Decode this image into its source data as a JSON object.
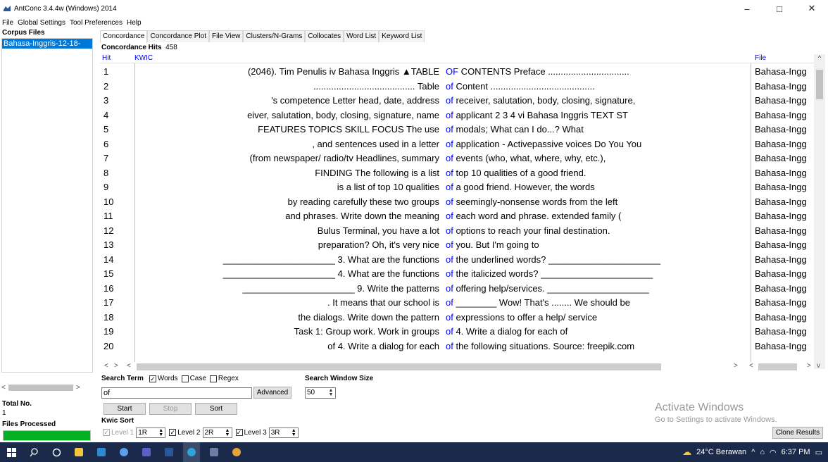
{
  "window": {
    "title": "AntConc 3.4.4w (Windows) 2014",
    "minimize": "–",
    "maximize": "□",
    "close": "✕"
  },
  "menu": [
    "File",
    "Global Settings",
    "Tool Preferences",
    "Help"
  ],
  "left_panel": {
    "corpus_files_label": "Corpus Files",
    "files": [
      "Bahasa-Inggris-12-18-"
    ],
    "scroll_left": "<",
    "scroll_right": ">",
    "total_no_label": "Total No.",
    "total_no_value": "1",
    "files_processed_label": "Files Processed",
    "files_processed_progress": 1.0
  },
  "tabs": [
    "Concordance",
    "Concordance Plot",
    "File View",
    "Clusters/N-Grams",
    "Collocates",
    "Word List",
    "Keyword List"
  ],
  "concordance": {
    "hits_label": "Concordance Hits",
    "hits_count": "458",
    "col_hit": "Hit",
    "col_kwic": "KWIC",
    "col_file": "File",
    "rows": [
      {
        "hit": "1",
        "left": "(2046). Tim Penulis  iv  Bahasa Inggris  ▲TABLE",
        "kw": "OF",
        "right": " CONTENTS  Preface ................................",
        "file": "Bahasa-Ingg"
      },
      {
        "hit": "2",
        "left": "........................................ Table",
        "kw": "of",
        "right": " Content .........................................",
        "file": "Bahasa-Ingg"
      },
      {
        "hit": "3",
        "left": "'s competence  Letter head, date, address",
        "kw": "of",
        "right": " receiver, salutation, body, closing, signature,",
        "file": "Bahasa-Ingg"
      },
      {
        "hit": "4",
        "left": "eiver, salutation, body, closing, signature, name",
        "kw": "of",
        "right": " applicant  2  3  4  vi  Bahasa Inggris  TEXT ST",
        "file": "Bahasa-Ingg"
      },
      {
        "hit": "5",
        "left": "FEATURES  TOPICS  SKILL FOCUS  The use",
        "kw": "of",
        "right": " modals; What can I do...? What",
        "file": "Bahasa-Ingg"
      },
      {
        "hit": "6",
        "left": ", and sentences used in a letter",
        "kw": "of",
        "right": " application - Activepassive voices  Do You  You",
        "file": "Bahasa-Ingg"
      },
      {
        "hit": "7",
        "left": "(from newspaper/ radio/tv  Headlines, summary",
        "kw": "of",
        "right": " events (who, what, where, why, etc.),",
        "file": "Bahasa-Ingg"
      },
      {
        "hit": "8",
        "left": "FINDING  The following is a list",
        "kw": "of",
        "right": " top 10 qualities of a good friend.",
        "file": "Bahasa-Ingg"
      },
      {
        "hit": "9",
        "left": "is a list of top 10 qualities",
        "kw": "of",
        "right": " a good friend. However, the words",
        "file": "Bahasa-Ingg"
      },
      {
        "hit": "10",
        "left": "by reading carefully these two groups",
        "kw": "of",
        "right": " seemingly-nonsense words from the left",
        "file": "Bahasa-Ingg"
      },
      {
        "hit": "11",
        "left": "and phrases. Write down the meaning",
        "kw": "of",
        "right": " each word and phrase.  extended family (",
        "file": "Bahasa-Ingg"
      },
      {
        "hit": "12",
        "left": "Bulus Terminal, you have a lot",
        "kw": "of",
        "right": " options to reach your final destination.",
        "file": "Bahasa-Ingg"
      },
      {
        "hit": "13",
        "left": "preparation? Oh, it's very nice",
        "kw": "of",
        "right": " you. But I'm going to",
        "file": "Bahasa-Ingg"
      },
      {
        "hit": "14",
        "left": "______________________ 3. What are the functions",
        "kw": "of",
        "right": " the underlined words?  ______________________",
        "file": "Bahasa-Ingg"
      },
      {
        "hit": "15",
        "left": "______________________ 4. What are the functions",
        "kw": "of",
        "right": " the italicized words?  ______________________",
        "file": "Bahasa-Ingg"
      },
      {
        "hit": "16",
        "left": "______________________ 9. Write the patterns",
        "kw": "of",
        "right": " offering help/services.  ____________________",
        "file": "Bahasa-Ingg"
      },
      {
        "hit": "17",
        "left": ". It means that our school is",
        "kw": "of",
        "right": " ________  Wow! That's ........ We should be",
        "file": "Bahasa-Ingg"
      },
      {
        "hit": "18",
        "left": "the dialogs. Write down the pattern",
        "kw": "of",
        "right": " expressions to offer a help/ service",
        "file": "Bahasa-Ingg"
      },
      {
        "hit": "19",
        "left": "Task 1: Group work. Work in groups",
        "kw": "of",
        "right": " 4. Write a dialog for each of",
        "file": "Bahasa-Ingg"
      },
      {
        "hit": "20",
        "left": "of 4. Write a dialog for each",
        "kw": "of",
        "right": " the following situations.  Source: freepik.com",
        "file": "Bahasa-Ingg"
      }
    ]
  },
  "search": {
    "term_label": "Search Term",
    "words_label": "Words",
    "words_checked": true,
    "case_label": "Case",
    "case_checked": false,
    "regex_label": "Regex",
    "regex_checked": false,
    "value": "of",
    "advanced_label": "Advanced",
    "window_size_label": "Search Window Size",
    "window_size_value": "50",
    "start_label": "Start",
    "stop_label": "Stop",
    "sort_label": "Sort"
  },
  "kwic_sort": {
    "label": "Kwic Sort",
    "level1_label": "Level 1",
    "level1_value": "1R",
    "level2_label": "Level 2",
    "level2_value": "2R",
    "level3_label": "Level 3",
    "level3_value": "3R"
  },
  "clone_results_label": "Clone Results",
  "watermark": {
    "line1": "Activate Windows",
    "line2": "Go to Settings to activate Windows."
  },
  "taskbar": {
    "weather": "24°C  Berawan",
    "time": "6:37 PM"
  },
  "colors": {
    "keyword": "#0000ff",
    "selection": "#0078d7",
    "progress": "#06b025",
    "taskbar": "#1b2a4a"
  }
}
